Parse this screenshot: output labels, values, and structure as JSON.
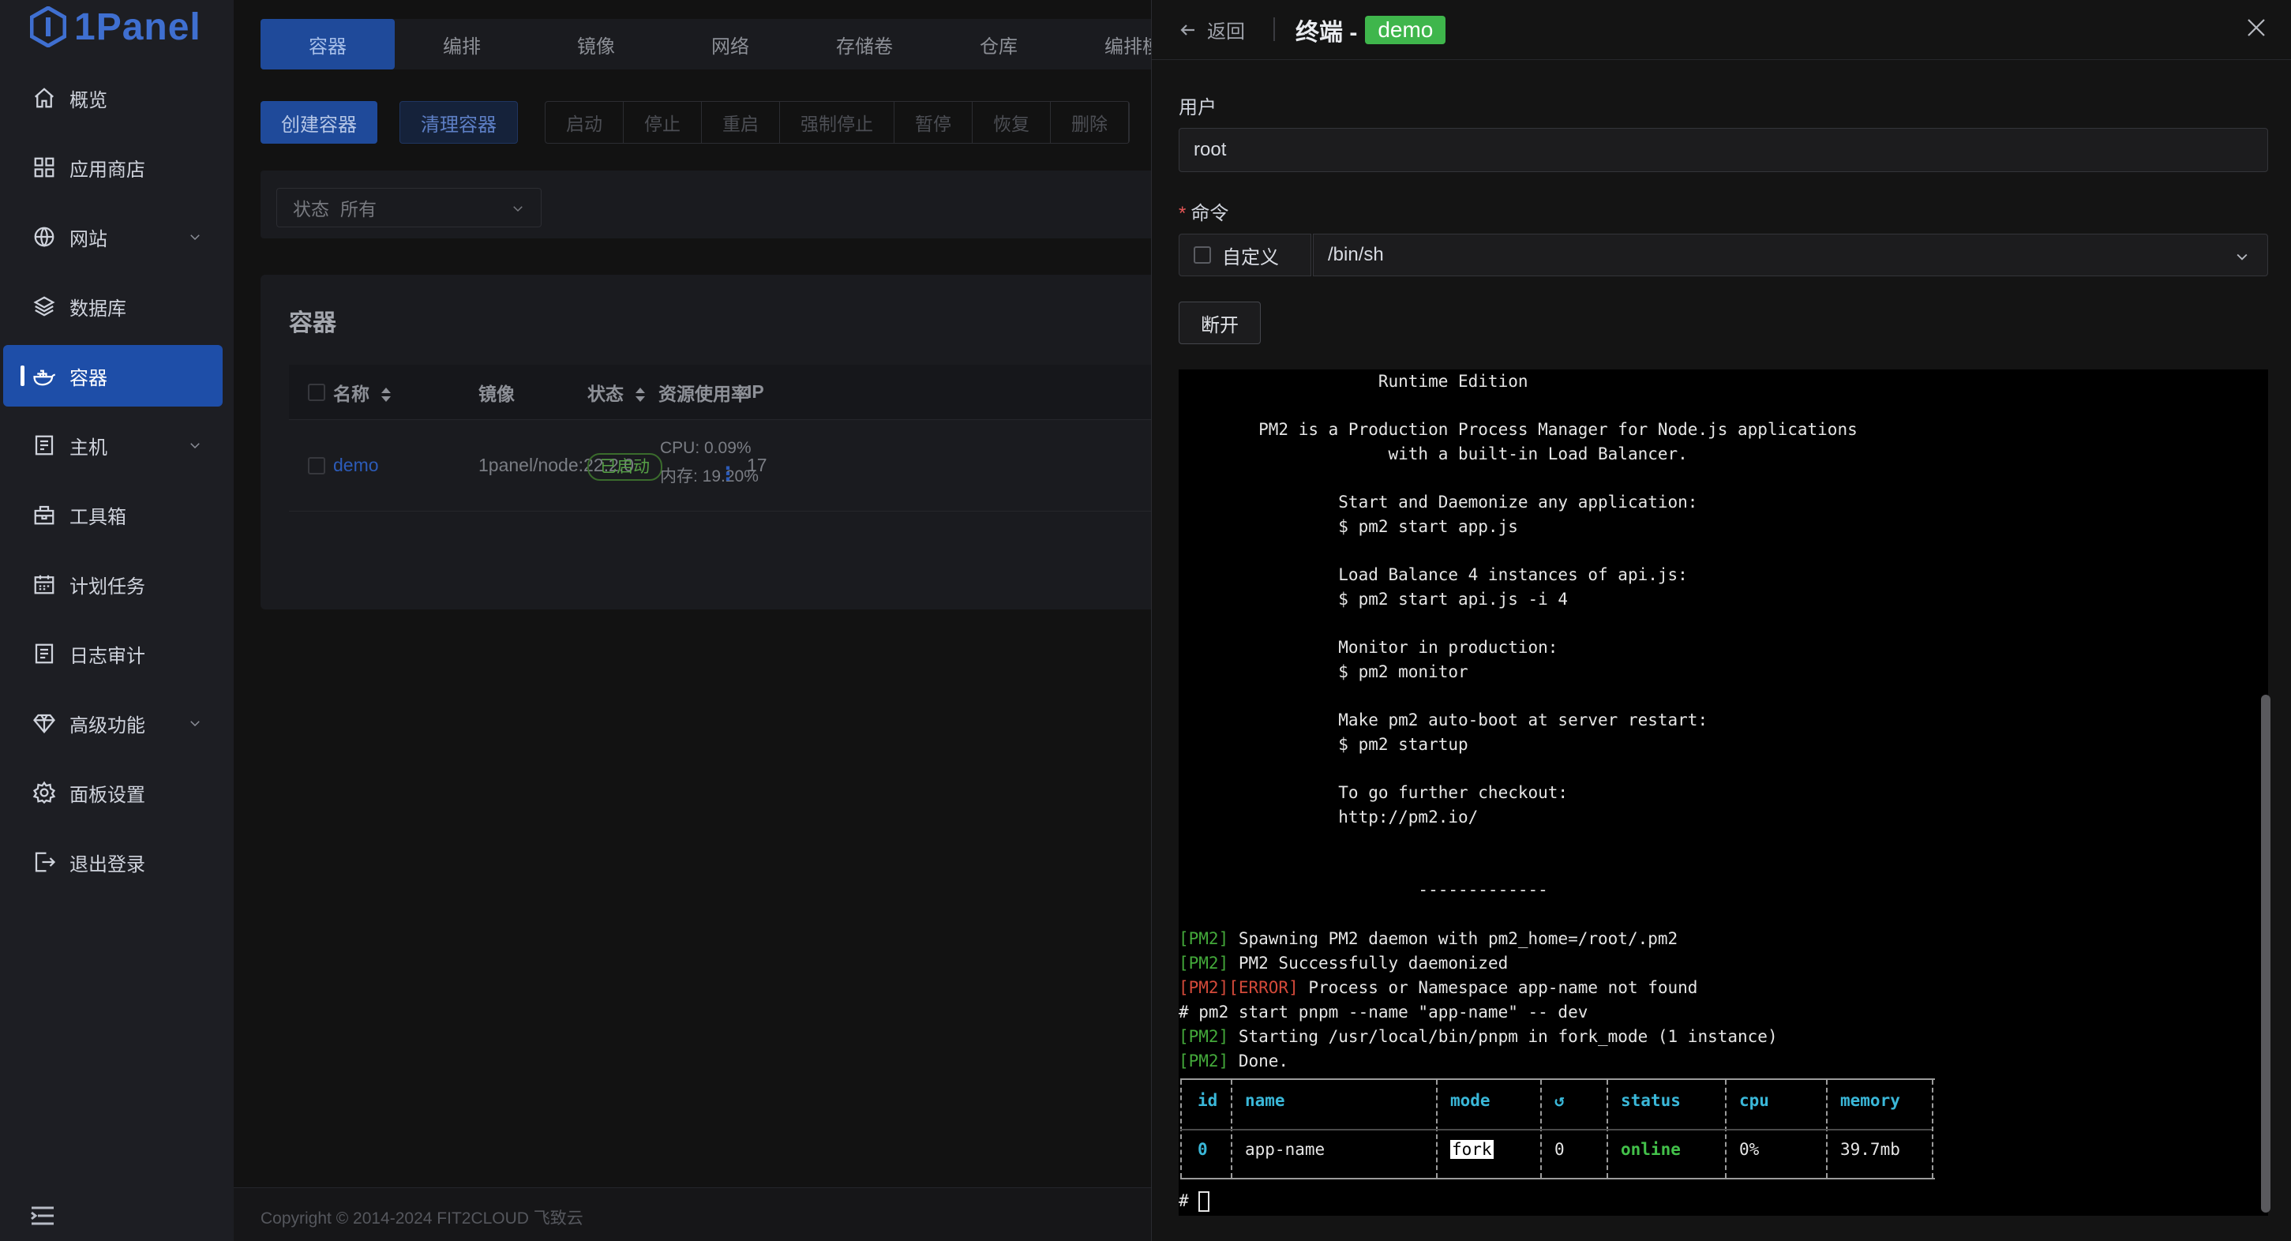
{
  "app": {
    "logo_text": "1Panel"
  },
  "sidebar": {
    "items": [
      {
        "label": "概览",
        "icon": "home-icon",
        "chevron": false
      },
      {
        "label": "应用商店",
        "icon": "grid-icon",
        "chevron": false
      },
      {
        "label": "网站",
        "icon": "globe-icon",
        "chevron": true
      },
      {
        "label": "数据库",
        "icon": "layers-icon",
        "chevron": false
      },
      {
        "label": "容器",
        "icon": "docker-icon",
        "chevron": false,
        "active": true
      },
      {
        "label": "主机",
        "icon": "server-icon",
        "chevron": true
      },
      {
        "label": "工具箱",
        "icon": "toolbox-icon",
        "chevron": false
      },
      {
        "label": "计划任务",
        "icon": "calendar-icon",
        "chevron": false
      },
      {
        "label": "日志审计",
        "icon": "log-icon",
        "chevron": false
      },
      {
        "label": "高级功能",
        "icon": "diamond-icon",
        "chevron": true
      },
      {
        "label": "面板设置",
        "icon": "gear-icon",
        "chevron": false
      },
      {
        "label": "退出登录",
        "icon": "logout-icon",
        "chevron": false
      }
    ]
  },
  "main": {
    "tabs": [
      "容器",
      "编排",
      "镜像",
      "网络",
      "存储卷",
      "仓库",
      "编排模"
    ],
    "toolbar": {
      "create": "创建容器",
      "clean": "清理容器",
      "actions": [
        "启动",
        "停止",
        "重启",
        "强制停止",
        "暂停",
        "恢复",
        "删除"
      ]
    },
    "filter": {
      "label": "状态",
      "value": "所有"
    },
    "card_title": "容器",
    "table": {
      "headers": {
        "name": "名称",
        "image": "镜像",
        "status": "状态",
        "usage": "资源使用率",
        "ip": "IP"
      },
      "rows": [
        {
          "name": "demo",
          "image": "1panel/node:22.2.0",
          "status": "已启动",
          "cpu": "CPU: 0.09%",
          "mem": "内存: 19.20%",
          "ip": "17"
        }
      ]
    },
    "copyright": "Copyright © 2014-2024 FIT2CLOUD 飞致云"
  },
  "drawer": {
    "back_label": "返回",
    "title": "终端 -",
    "tag": "demo",
    "user_label": "用户",
    "user_value": "root",
    "command_label": "命令",
    "custom_label": "自定义",
    "command_value": "/bin/sh",
    "disconnect_label": "断开"
  },
  "terminal": {
    "lines": {
      "l1": "                    Runtime Edition",
      "l2": "",
      "l3": "        PM2 is a Production Process Manager for Node.js applications",
      "l4": "                     with a built-in Load Balancer.",
      "l5": "",
      "l6": "                Start and Daemonize any application:",
      "l7": "                $ pm2 start app.js",
      "l8": "",
      "l9": "                Load Balance 4 instances of api.js:",
      "l10": "                $ pm2 start api.js -i 4",
      "l11": "",
      "l12": "                Monitor in production:",
      "l13": "                $ pm2 monitor",
      "l14": "",
      "l15": "                Make pm2 auto-boot at server restart:",
      "l16": "                $ pm2 startup",
      "l17": "",
      "l18": "                To go further checkout:",
      "l19": "                http://pm2.io/",
      "l20": "",
      "l21": "",
      "l22": "                        -------------"
    },
    "log": [
      {
        "tag": "[PM2]",
        "error": "",
        "text": " Spawning PM2 daemon with pm2_home=/root/.pm2"
      },
      {
        "tag": "[PM2]",
        "error": "",
        "text": " PM2 Successfully daemonized"
      },
      {
        "tag": "",
        "error": "[PM2][ERROR]",
        "text": " Process or Namespace app-name not found"
      },
      {
        "tag": "",
        "error": "",
        "text": "# pm2 start pnpm --name \"app-name\" -- dev"
      },
      {
        "tag": "[PM2]",
        "error": "",
        "text": " Starting /usr/local/bin/pnpm in fork_mode (1 instance)"
      },
      {
        "tag": "[PM2]",
        "error": "",
        "text": " Done."
      }
    ],
    "pm2_table": {
      "headers": [
        "id",
        "name",
        "mode",
        "↺",
        "status",
        "cpu",
        "memory"
      ],
      "row": [
        "0",
        "app-name",
        "fork",
        "0",
        "online",
        "0%",
        "39.7mb"
      ]
    },
    "prompt": "#"
  }
}
